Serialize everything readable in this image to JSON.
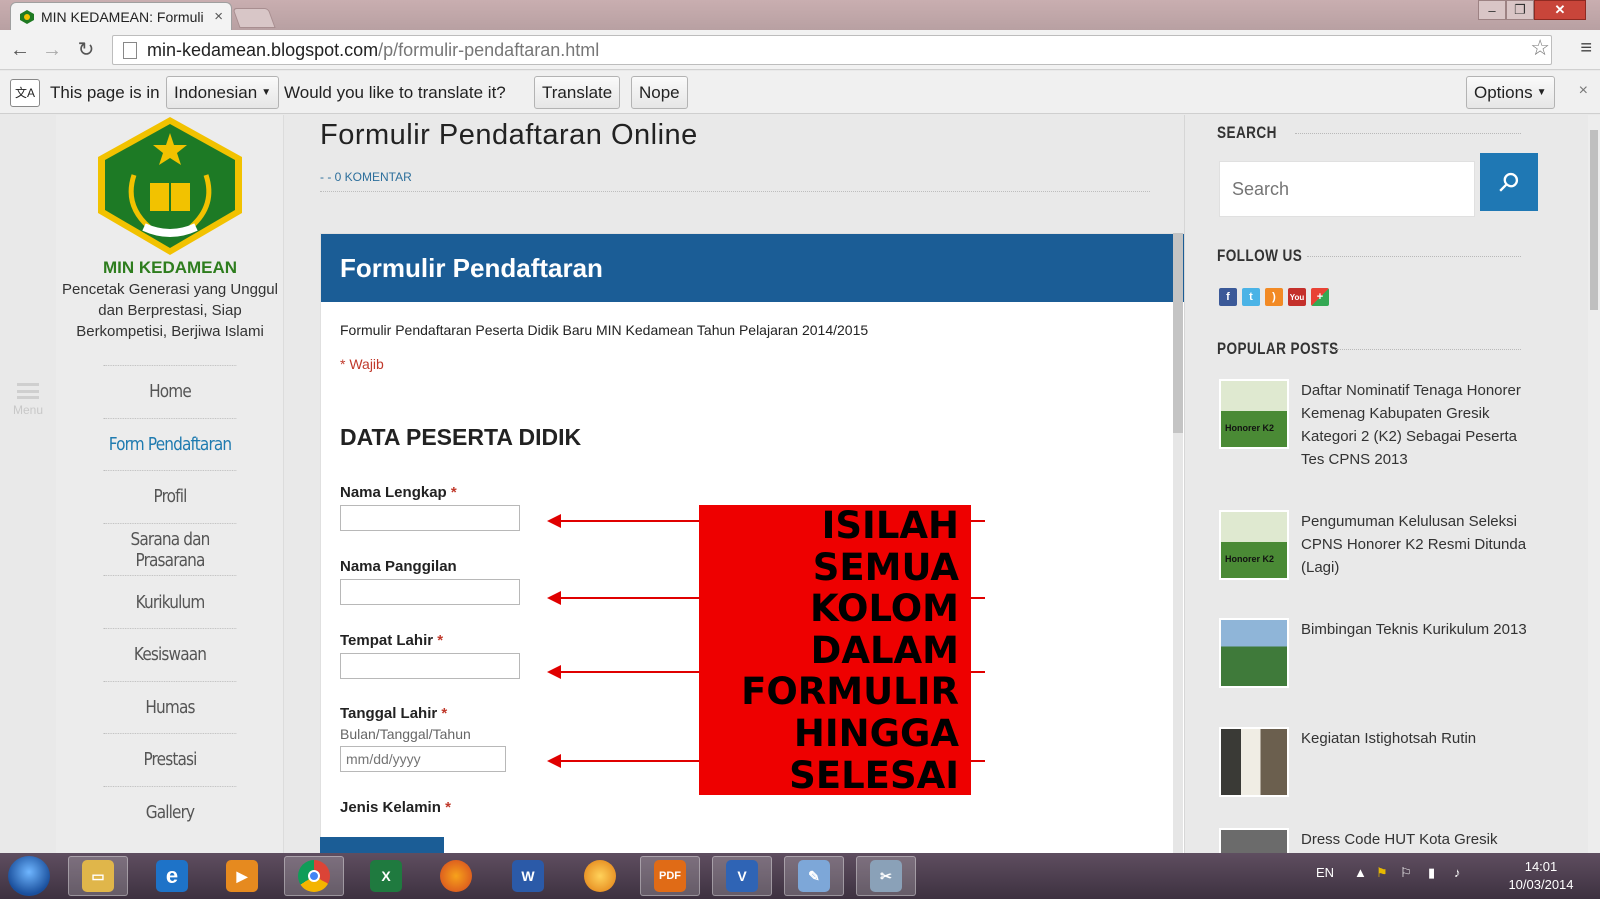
{
  "browser": {
    "tab_title": "MIN KEDAMEAN: Formuli",
    "tab_close": "×",
    "url_host": "min-kedamean.blogspot.com",
    "url_path": "/p/formulir-pendaftaran.html"
  },
  "translate_bar": {
    "lead": "This page is in",
    "language": "Indonesian",
    "question": "Would you like to translate it?",
    "translate_label": "Translate",
    "nope_label": "Nope",
    "options_label": "Options",
    "close": "×"
  },
  "site": {
    "name": "MIN KEDAMEAN",
    "tagline": "Pencetak Generasi yang Unggul dan Berprestasi, Siap Berkompetisi, Berjiwa Islami",
    "menu_label": "Menu",
    "nav": [
      {
        "label": "Home"
      },
      {
        "label": "Form Pendaftaran"
      },
      {
        "label": "Profil"
      },
      {
        "label": "Sarana dan Prasarana"
      },
      {
        "label": "Kurikulum"
      },
      {
        "label": "Kesiswaan"
      },
      {
        "label": "Humas"
      },
      {
        "label": "Prestasi"
      },
      {
        "label": "Gallery"
      }
    ]
  },
  "post": {
    "title": "Formulir Pendaftaran Online",
    "meta": "- - 0 KOMENTAR"
  },
  "form": {
    "header": "Formulir Pendaftaran",
    "description": "Formulir Pendaftaran Peserta Didik Baru MIN Kedamean Tahun Pelajaran 2014/2015",
    "required_note": "* Wajib",
    "section": "DATA PESERTA DIDIK",
    "required_mark": "*",
    "fields": [
      {
        "label": "Nama Lengkap",
        "required": true
      },
      {
        "label": "Nama Panggilan",
        "required": false
      },
      {
        "label": "Tempat Lahir",
        "required": true
      },
      {
        "label": "Tanggal Lahir",
        "required": true,
        "help": "Bulan/Tanggal/Tahun",
        "placeholder": "mm/dd/yyyy"
      },
      {
        "label": "Jenis Kelamin",
        "required": true
      }
    ]
  },
  "callout": {
    "lines": [
      "ISILAH",
      "SEMUA",
      "KOLOM",
      "DALAM",
      "FORMULIR",
      "HINGGA",
      "SELESAI"
    ],
    "color": "#ee0000"
  },
  "sidebar": {
    "search_heading": "SEARCH",
    "search_placeholder": "Search",
    "follow_heading": "FOLLOW US",
    "popular_heading": "POPULAR POSTS",
    "popular_posts": [
      {
        "title": "Daftar Nominatif Tenaga Honorer Kemenag Kabupaten Gresik Kategori 2 (K2) Sebagai Peserta Tes CPNS 2013",
        "thumb_label": "Honorer K2"
      },
      {
        "title": "Pengumuman Kelulusan Seleksi CPNS Honorer K2 Resmi Ditunda (Lagi)",
        "thumb_label": "Honorer K2"
      },
      {
        "title": "Bimbingan Teknis Kurikulum 2013",
        "thumb_label": ""
      },
      {
        "title": "Kegiatan Istighotsah Rutin",
        "thumb_label": ""
      },
      {
        "title": "Dress Code HUT Kota Gresik",
        "thumb_label": ""
      }
    ],
    "social_icons": [
      "facebook-icon",
      "twitter-icon",
      "rss-icon",
      "youtube-icon",
      "google-plus-icon"
    ]
  },
  "taskbar": {
    "language": "EN",
    "time": "14:01",
    "date": "10/03/2014"
  },
  "colors": {
    "header_blue": "#1b5d96",
    "search_button": "#1f78b4",
    "brand_green": "#2e7d1e",
    "required_red": "#c0392b"
  }
}
